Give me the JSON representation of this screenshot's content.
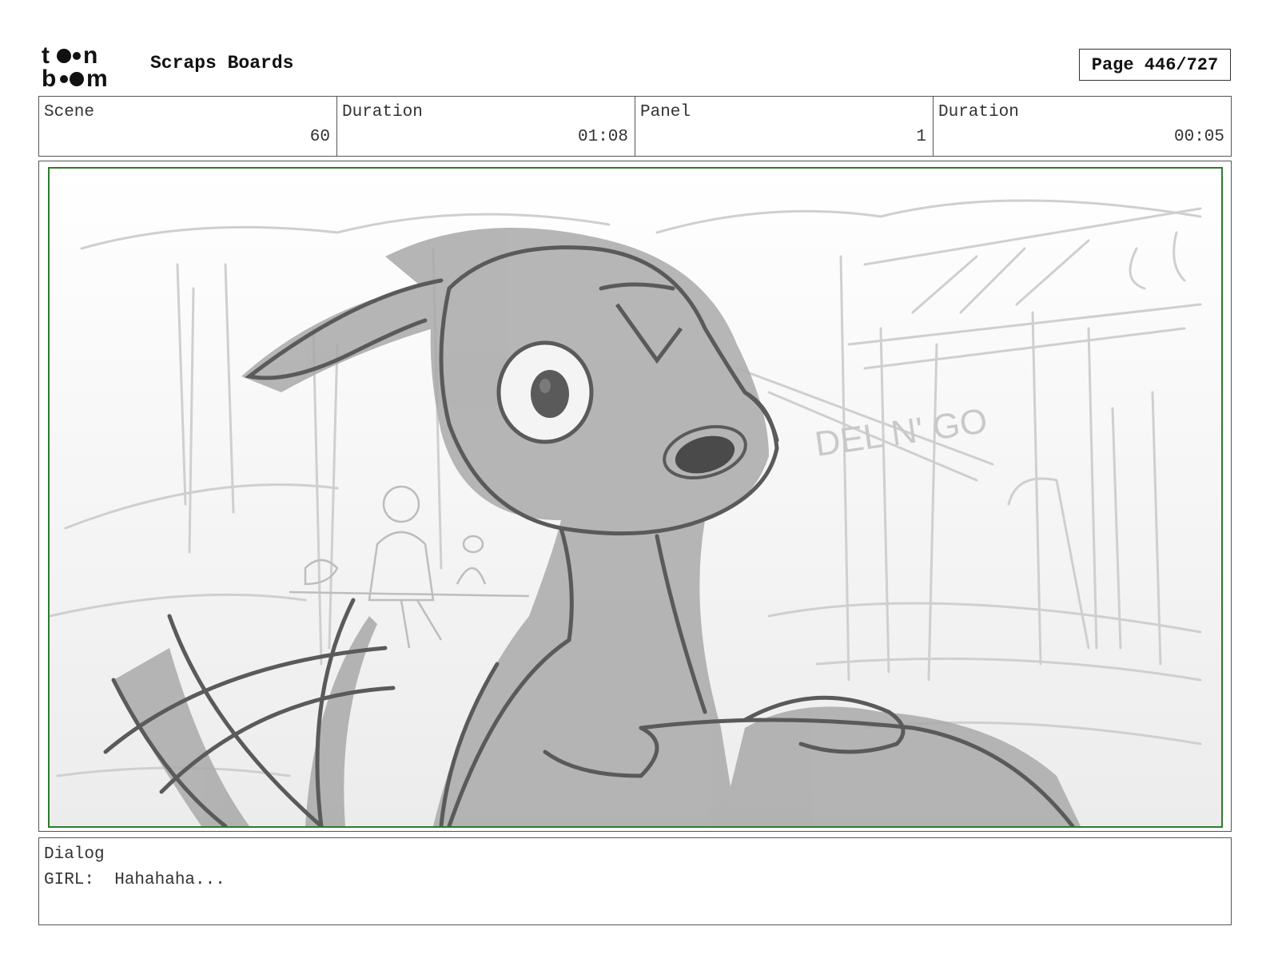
{
  "header": {
    "logo_text": "toon boom",
    "board_title": "Scraps Boards",
    "page_label": "Page 446/727"
  },
  "info": {
    "scene_label": "Scene",
    "scene_value": "60",
    "scene_duration_label": "Duration",
    "scene_duration_value": "01:08",
    "panel_label": "Panel",
    "panel_value": "1",
    "panel_duration_label": "Duration",
    "panel_duration_value": "00:05"
  },
  "panel_image": {
    "sign_text": "DEL N' GO",
    "frame_color": "#2d7a2d"
  },
  "dialog": {
    "label": "Dialog",
    "text": "GIRL:  Hahahaha..."
  }
}
